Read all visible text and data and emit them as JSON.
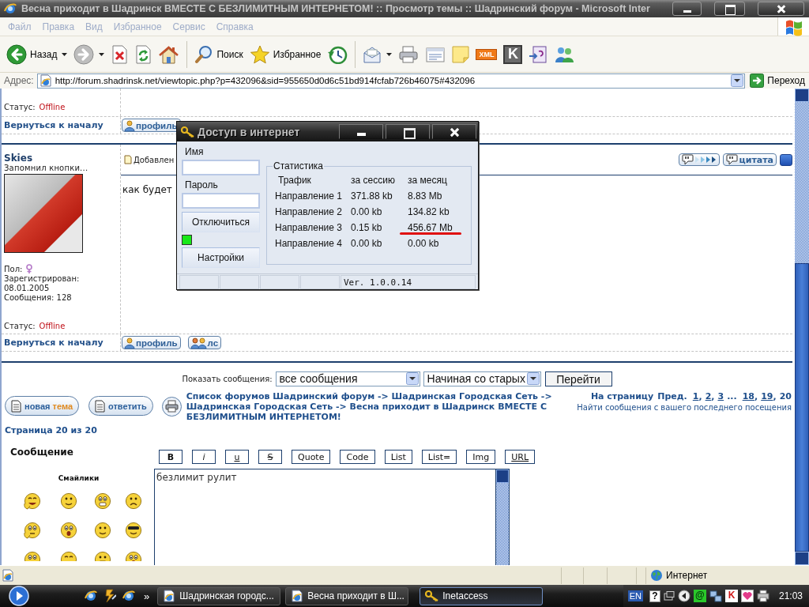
{
  "browser": {
    "title": "Весна приходит в Шадринск ВМЕСТЕ С БЕЗЛИМИТНЫМ ИНТЕРНЕТОМ! :: Просмотр темы :: Шадринский форум - Microsoft Inter",
    "active": false
  },
  "menu": [
    "Файл",
    "Правка",
    "Вид",
    "Избранное",
    "Сервис",
    "Справка"
  ],
  "toolbar": {
    "back": "Назад",
    "search": "Поиск",
    "favorites": "Избранное",
    "xml_badge": "XML",
    "k_tile": "K"
  },
  "address": {
    "label": "Адрес:",
    "url": "http://forum.shadrinsk.net/viewtopic.php?p=432096&sid=955650d0d6c51bd914fcfab726b46075#432096",
    "go": "Переход"
  },
  "forum": {
    "previous_post": {
      "status_label": "Статус:",
      "status": "Offline",
      "back_to_top": "Вернуться к началу",
      "buttons": [
        "профиль"
      ]
    },
    "post": {
      "author": "Skies",
      "rank": "Запомнил кнопки...",
      "gender_label": "Пол:",
      "details": [
        "Зарегистрирован:",
        "08.01.2005",
        "Сообщения: 128"
      ],
      "status_label": "Статус:",
      "status": "Offline",
      "posted": "Добавлен",
      "quote": "цитата",
      "body": "как будет",
      "back_to_top": "Вернуться к началу",
      "buttons": [
        "профиль",
        "лс"
      ]
    },
    "display": {
      "label": "Показать сообщения:",
      "filter": "все сообщения",
      "order": "Начиная со старых",
      "go": "Перейти"
    },
    "new_topic": {
      "label": "новая",
      "accent": "тема"
    },
    "reply": "ответить",
    "breadcrumb": "Список форумов Шадринский форум -> Шадринская Городская Сеть -> Шадринская Городская Сеть -> Весна приходит в Шадринск ВМЕСТЕ С БЕЗЛИМИТНЫМ ИНТЕРНЕТОМ!",
    "pagination": {
      "label": "На страницу",
      "prev": "Пред.",
      "separator": ",",
      "pages_before": [
        {
          "label": "1",
          "selected": false
        },
        {
          "label": "2",
          "selected": false
        },
        {
          "label": "3",
          "selected": false
        }
      ],
      "gap": "...",
      "pages_after": [
        {
          "label": "18",
          "selected": false
        },
        {
          "label": "19",
          "selected": false
        },
        {
          "label": "20",
          "selected": true
        }
      ]
    },
    "find_new": "Найти сообщения с вашего последнего посещения",
    "page_info": "Страница 20 из 20"
  },
  "editor": {
    "label": "Сообщение",
    "smilies_label": "Смайлики",
    "tags": [
      {
        "label": "B",
        "kind": "bold"
      },
      {
        "label": "i",
        "kind": "italic"
      },
      {
        "label": "u",
        "kind": "underline"
      },
      {
        "label": "S",
        "kind": "strike"
      },
      {
        "label": "Quote",
        "kind": "plain"
      },
      {
        "label": "Code",
        "kind": "plain"
      },
      {
        "label": "List",
        "kind": "plain"
      },
      {
        "label": "List=",
        "kind": "plain"
      },
      {
        "label": "Img",
        "kind": "plain"
      },
      {
        "label": "URL",
        "kind": "underline"
      }
    ],
    "text": "безлимит рулит"
  },
  "popup": {
    "title": "Доступ в интернет",
    "login_label": "Имя",
    "password_label": "Пароль",
    "disconnect": "Отключиться",
    "connected": true,
    "settings": "Настройки",
    "stats": {
      "legend": "Статистика",
      "columns": [
        "Трафик",
        "за сессию",
        "за месяц"
      ],
      "rows": [
        {
          "direction": "Направление 1",
          "session": "371.88 kb",
          "month": "8.83 Mb",
          "highlighted": false
        },
        {
          "direction": "Направление 2",
          "session": "0.00 kb",
          "month": "134.82 kb",
          "highlighted": false
        },
        {
          "direction": "Направление 3",
          "session": "0.15 kb",
          "month": "456.67 Mb",
          "highlighted": true
        },
        {
          "direction": "Направление 4",
          "session": "0.00 kb",
          "month": "0.00 kb",
          "highlighted": false
        }
      ]
    },
    "version": "Ver. 1.0.0.14"
  },
  "status_bar": {
    "zone": "Интернет"
  },
  "taskbar": {
    "more": "»",
    "tasks": [
      {
        "label": "Шадринская городс...",
        "kind": "page",
        "selected": false
      },
      {
        "label": "Весна приходит в Ш...",
        "kind": "page",
        "selected": false
      },
      {
        "label": "Inetaccess",
        "kind": "key",
        "selected": true
      }
    ],
    "tray": {
      "language": "EN",
      "help": "?",
      "mail": "@",
      "k_tile": "K",
      "clock": "21:03"
    }
  }
}
